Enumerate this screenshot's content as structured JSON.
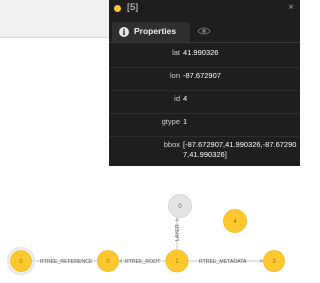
{
  "panel": {
    "title": "[5]",
    "close_glyph": "×",
    "tabs": [
      {
        "label": "Properties",
        "icon": "info-icon",
        "icon_glyph": "i"
      },
      {
        "label": "",
        "icon": "eye-icon"
      }
    ],
    "properties": [
      {
        "key": "lat",
        "value": "41.990326"
      },
      {
        "key": "lon",
        "value": "-87.672907"
      },
      {
        "key": "id",
        "value": "4"
      },
      {
        "key": "gtype",
        "value": "1"
      },
      {
        "key": "bbox",
        "value": "[-87.672907,41.990326,-87.672907,41.990326]"
      }
    ]
  },
  "graph": {
    "nodes": [
      {
        "label": "0",
        "color": "#e3e3e3"
      },
      {
        "label": "4",
        "color": "#ffc82e"
      },
      {
        "label": "0",
        "color": "#ffc82e"
      },
      {
        "label": "0",
        "color": "#ffc82e"
      },
      {
        "label": "1",
        "color": "#ffc82e"
      },
      {
        "label": "3",
        "color": "#ffc82e"
      }
    ],
    "edges": [
      {
        "label": "RTREE_REFERENCE"
      },
      {
        "label": "RTREE_ROOT"
      },
      {
        "label": "LAYER"
      },
      {
        "label": "RTREE_METADATA"
      }
    ]
  },
  "colors": {
    "panel_bg": "#1e1e1e",
    "node_yellow": "#ffc82e",
    "node_grey": "#e3e3e3"
  }
}
